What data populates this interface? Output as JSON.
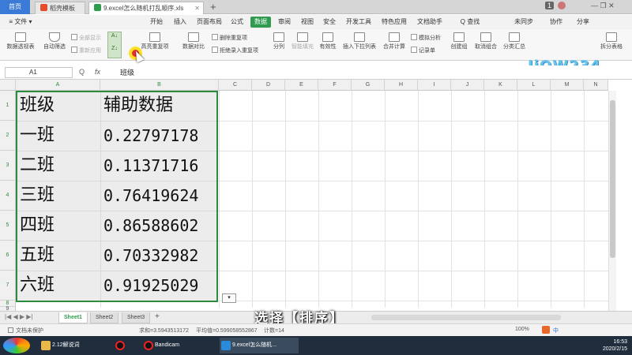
{
  "titlebar": {
    "home_tab": "首页",
    "template_tab": "稻壳模板",
    "file_tab": "9.excel怎么随机打乱顺序.xls",
    "new_tab_symbol": "+",
    "user_badge": "1",
    "controls": "— ❐ ✕"
  },
  "menubar": {
    "file_label": "≡ 文件 ▾",
    "items": [
      "开始",
      "插入",
      "页面布局",
      "公式",
      "数据",
      "审阅",
      "视图",
      "安全",
      "开发工具",
      "特色应用",
      "文档助手"
    ],
    "active": "数据",
    "search": "Q 查找",
    "sync": "未同步",
    "collab": "协作",
    "share": "分享"
  },
  "ribbon": {
    "pivot": "数据透视表",
    "autofilter": "自动筛选",
    "showall": "全部显示",
    "reapply": "重新应用",
    "sortup": "A↓",
    "sortdown": "Z↓",
    "highlight_dup": "高亮重复项",
    "delete_dup": "删除重复项",
    "reject_dup": "拒绝录入重复项",
    "compare": "数据对比",
    "split": "分列",
    "fill": "智能填充",
    "validity": "有效性",
    "dropdown": "插入下拉列表",
    "consolidate": "合并计算",
    "simulate": "模拟分析",
    "record": "记录单",
    "create_group": "创建组",
    "ungroup": "取消组合",
    "subtotal": "分类汇总",
    "split_table": "拆分表格",
    "logo": "JiOW234"
  },
  "formula": {
    "cell_ref": "A1",
    "content": "班级"
  },
  "columns": [
    "A",
    "B",
    "C",
    "D",
    "E",
    "F",
    "G",
    "H",
    "I",
    "J",
    "K",
    "L",
    "M",
    "N"
  ],
  "rows": [
    "1",
    "2",
    "3",
    "4",
    "5",
    "6",
    "7",
    "8",
    "9"
  ],
  "table": {
    "header": [
      "班级",
      "辅助数据"
    ],
    "rows": [
      [
        "一班",
        "0.22797178"
      ],
      [
        "二班",
        "0.11371716"
      ],
      [
        "三班",
        "0.76419624"
      ],
      [
        "四班",
        "0.86588602"
      ],
      [
        "五班",
        "0.70332982"
      ],
      [
        "六班",
        "0.91925029"
      ]
    ]
  },
  "sheets": [
    "Sheet1",
    "Sheet2",
    "Sheet3"
  ],
  "active_sheet": "Sheet1",
  "subtitle": "选择【排序】",
  "status": {
    "protect": "文档未保护",
    "sum": "求和=3.5943513172",
    "avg": "平均值=0.599058552867",
    "count": "计数=14",
    "zoom": "100%"
  },
  "taskbar": {
    "items": [
      "2.12解说词",
      "",
      "Bandicam",
      "9.excel怎么随机..."
    ],
    "time": "16:53",
    "date": "2020/2/15",
    "lang": "中"
  }
}
